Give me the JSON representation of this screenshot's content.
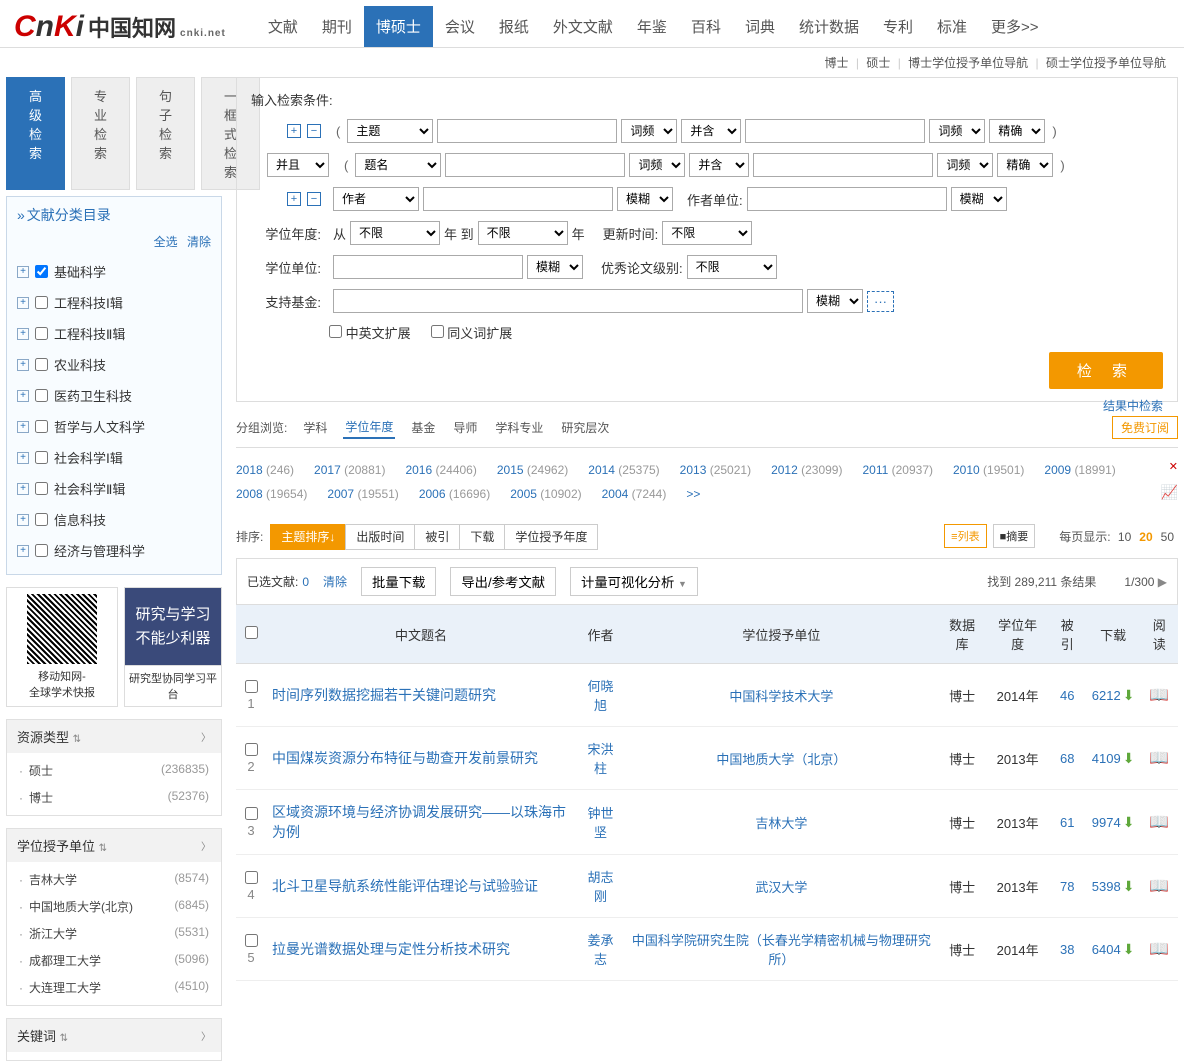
{
  "logo": {
    "c": "C",
    "n": "n",
    "k": "K",
    "i": "i",
    "cn": "中国知网",
    "sub": "cnki.net"
  },
  "topnav": [
    "文献",
    "期刊",
    "博硕士",
    "会议",
    "报纸",
    "外文文献",
    "年鉴",
    "百科",
    "词典",
    "统计数据",
    "专利",
    "标准",
    "更多>>"
  ],
  "topnav_active": 2,
  "subnav": [
    "博士",
    "硕士",
    "博士学位授予单位导航",
    "硕士学位授予单位导航"
  ],
  "search_tabs": [
    "高级检索",
    "专业检索",
    "句子检索",
    "一框式检索"
  ],
  "search_tabs_active": 0,
  "catalog": {
    "title": "文献分类目录",
    "select_all": "全选",
    "clear": "清除",
    "items": [
      {
        "label": "基础科学",
        "checked": true
      },
      {
        "label": "工程科技Ⅰ辑",
        "checked": false
      },
      {
        "label": "工程科技Ⅱ辑",
        "checked": false
      },
      {
        "label": "农业科技",
        "checked": false
      },
      {
        "label": "医药卫生科技",
        "checked": false
      },
      {
        "label": "哲学与人文科学",
        "checked": false
      },
      {
        "label": "社会科学Ⅰ辑",
        "checked": false
      },
      {
        "label": "社会科学Ⅱ辑",
        "checked": false
      },
      {
        "label": "信息科技",
        "checked": false
      },
      {
        "label": "经济与管理科学",
        "checked": false
      }
    ]
  },
  "promo": {
    "qr_line1": "移动知网-",
    "qr_line2": "全球学术快报",
    "ad_line1": "研究与学习",
    "ad_line2": "不能少利器",
    "ad_caption": "研究型协同学习平台"
  },
  "facets": [
    {
      "title": "资源类型",
      "expand_icon": "⇅",
      "items": [
        {
          "label": "硕士",
          "count": "(236835)"
        },
        {
          "label": "博士",
          "count": "(52376)"
        }
      ]
    },
    {
      "title": "学位授予单位",
      "expand_icon": "⇅",
      "items": [
        {
          "label": "吉林大学",
          "count": "(8574)"
        },
        {
          "label": "中国地质大学(北京)",
          "count": "(6845)"
        },
        {
          "label": "浙江大学",
          "count": "(5531)"
        },
        {
          "label": "成都理工大学",
          "count": "(5096)"
        },
        {
          "label": "大连理工大学",
          "count": "(4510)"
        }
      ]
    },
    {
      "title": "关键词",
      "expand_icon": "⇅",
      "items": []
    }
  ],
  "cond": {
    "header": "输入检索条件:",
    "field_subject": "主题",
    "field_title": "题名",
    "field_author": "作者",
    "freq": "词频",
    "comb_andor": "并含",
    "logic_and": "并且",
    "precise": "精确",
    "fuzzy": "模糊",
    "author_unit": "作者单位:",
    "degree_year": "学位年度:",
    "from": "从",
    "to_year": "年 到",
    "year_suffix": "年",
    "unlimited": "不限",
    "update_time": "更新时间:",
    "degree_unit": "学位单位:",
    "excellent": "优秀论文级别:",
    "fund": "支持基金:",
    "ext_cn_en": "中英文扩展",
    "ext_syn": "同义词扩展",
    "search_btn": "检 索",
    "search_in_results": "结果中检索"
  },
  "group": {
    "label": "分组浏览:",
    "items": [
      "学科",
      "学位年度",
      "基金",
      "导师",
      "学科专业",
      "研究层次"
    ],
    "active": 1,
    "free": "免费订阅"
  },
  "years": [
    {
      "y": "2018",
      "c": "(246)"
    },
    {
      "y": "2017",
      "c": "(20881)"
    },
    {
      "y": "2016",
      "c": "(24406)"
    },
    {
      "y": "2015",
      "c": "(24962)"
    },
    {
      "y": "2014",
      "c": "(25375)"
    },
    {
      "y": "2013",
      "c": "(25021)"
    },
    {
      "y": "2012",
      "c": "(23099)"
    },
    {
      "y": "2011",
      "c": "(20937)"
    },
    {
      "y": "2010",
      "c": "(19501)"
    },
    {
      "y": "2009",
      "c": "(18991)"
    },
    {
      "y": "2008",
      "c": "(19654)"
    },
    {
      "y": "2007",
      "c": "(19551)"
    },
    {
      "y": "2006",
      "c": "(16696)"
    },
    {
      "y": "2005",
      "c": "(10902)"
    },
    {
      "y": "2004",
      "c": "(7244)"
    }
  ],
  "years_more": ">>",
  "sort": {
    "label": "排序:",
    "items": [
      "主题排序↓",
      "出版时间",
      "被引",
      "下载",
      "学位授予年度"
    ],
    "active": 0,
    "view_list": "≡列表",
    "view_summary": "■摘要",
    "per_page_label": "每页显示:",
    "per_page_options": [
      "10",
      "20",
      "50"
    ],
    "per_page_active": 1
  },
  "selbar": {
    "label": "已选文献:",
    "count": "0",
    "clear": "清除",
    "batch_dl": "批量下载",
    "export": "导出/参考文献",
    "viz": "计量可视化分析",
    "found_prefix": "找到 ",
    "found_count": "289,211",
    "found_suffix": " 条结果",
    "page_info": "1/300",
    "next": "▶"
  },
  "table": {
    "headers": [
      "",
      "中文题名",
      "作者",
      "学位授予单位",
      "数据库",
      "学位年度",
      "被引",
      "下载",
      "阅读"
    ],
    "rows": [
      {
        "idx": "1",
        "title": "时间序列数据挖掘若干关键问题研究",
        "author": "何晓旭",
        "inst": "中国科学技术大学",
        "db": "博士",
        "year": "2014年",
        "cited": "46",
        "dl": "6212"
      },
      {
        "idx": "2",
        "title": "中国煤炭资源分布特征与勘查开发前景研究",
        "author": "宋洪柱",
        "inst": "中国地质大学（北京）",
        "db": "博士",
        "year": "2013年",
        "cited": "68",
        "dl": "4109"
      },
      {
        "idx": "3",
        "title": "区域资源环境与经济协调发展研究——以珠海市为例",
        "author": "钟世坚",
        "inst": "吉林大学",
        "db": "博士",
        "year": "2013年",
        "cited": "61",
        "dl": "9974"
      },
      {
        "idx": "4",
        "title": "北斗卫星导航系统性能评估理论与试验验证",
        "author": "胡志刚",
        "inst": "武汉大学",
        "db": "博士",
        "year": "2013年",
        "cited": "78",
        "dl": "5398"
      },
      {
        "idx": "5",
        "title": "拉曼光谱数据处理与定性分析技术研究",
        "author": "姜承志",
        "inst": "中国科学院研究生院（长春光学精密机械与物理研究所）",
        "db": "博士",
        "year": "2014年",
        "cited": "38",
        "dl": "6404"
      }
    ]
  }
}
